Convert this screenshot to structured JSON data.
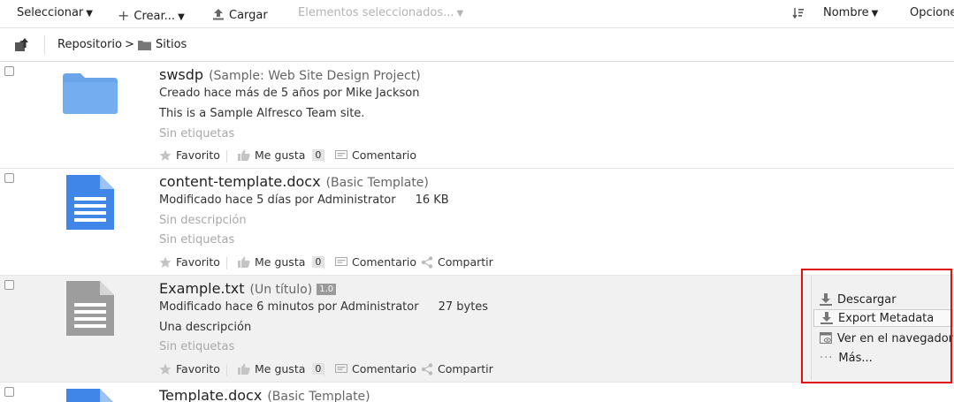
{
  "toolbar": {
    "select": "Seleccionar",
    "create": "Crear...",
    "upload": "Cargar",
    "selected_items": "Elementos seleccionados...",
    "sort_field": "Nombre",
    "options": "Opcione"
  },
  "breadcrumb": {
    "root": "Repositorio",
    "separator": ">",
    "current": "Sitios"
  },
  "rows": [
    {
      "name": "swsdp",
      "title": "(Sample: Web Site Design Project)",
      "meta": "Creado hace más de 5 años por Mike Jackson",
      "description": "This is a Sample Alfresco Team site.",
      "tags": "Sin etiquetas",
      "favorite": "Favorito",
      "like": "Me gusta",
      "like_count": "0",
      "comment": "Comentario"
    },
    {
      "name": "content-template.docx",
      "title": "(Basic Template)",
      "meta": "Modificado hace 5 días por Administrator",
      "size": "16 KB",
      "description": "Sin descripción",
      "tags": "Sin etiquetas",
      "favorite": "Favorito",
      "like": "Me gusta",
      "like_count": "0",
      "comment": "Comentario",
      "share": "Compartir"
    },
    {
      "name": "Example.txt",
      "title": "(Un título)",
      "version": "1.0",
      "meta": "Modificado hace 6 minutos por Administrator",
      "size": "27 bytes",
      "description": "Una descripción",
      "tags": "Sin etiquetas",
      "favorite": "Favorito",
      "like": "Me gusta",
      "like_count": "0",
      "comment": "Comentario",
      "share": "Compartir"
    },
    {
      "name": "Template.docx",
      "title": "(Basic Template)"
    }
  ],
  "menu": {
    "download": "Descargar",
    "export_metadata": "Export Metadata",
    "view_in_browser": "Ver en el navegador",
    "more": "Más..."
  },
  "colors": {
    "folder": "#6aa5ea",
    "doc_blue": "#3f86e8",
    "txt_gray": "#9d9d9d",
    "highlight_border": "#dd1111"
  }
}
